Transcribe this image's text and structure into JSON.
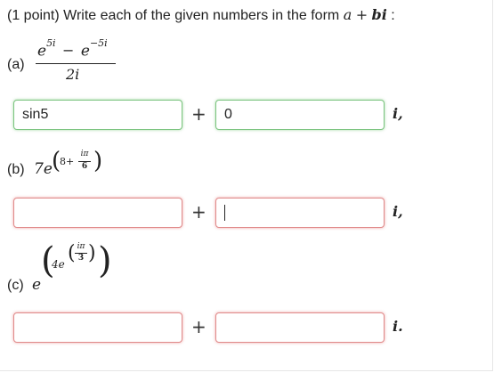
{
  "header": {
    "points": "(1 point)",
    "prompt": "Write each of the given numbers in the form",
    "form_a": "a",
    "form_plus": "+",
    "form_bi": "bi",
    "colon": ":"
  },
  "parts": {
    "a": {
      "label": "(a)",
      "num_base1": "e",
      "num_exp1": "5i",
      "num_minus": "−",
      "num_base2": "e",
      "num_exp2": "−5i",
      "den": "2i",
      "real_value": "sin5",
      "imag_value": "0",
      "plus": "+",
      "unit": "i,"
    },
    "b": {
      "label": "(b)",
      "coef": "7e",
      "exp_num_left": "8+",
      "exp_frac_num": "iπ",
      "exp_frac_den": "6",
      "real_value": "",
      "imag_value": "",
      "plus": "+",
      "unit": "i,"
    },
    "c": {
      "label": "(c)",
      "base": "e",
      "inner_coef": "4e",
      "inner_frac_num": "iπ",
      "inner_frac_den": "3",
      "real_value": "",
      "imag_value": "",
      "plus": "+",
      "unit": "i."
    }
  }
}
